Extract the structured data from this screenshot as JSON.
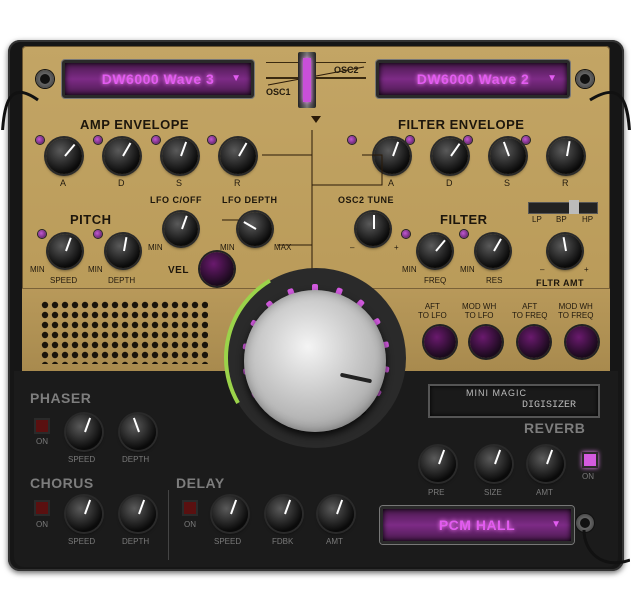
{
  "osc": {
    "osc1_wave": "DW6000 Wave 3",
    "osc2_wave": "DW6000 Wave 2",
    "osc1_label": "OSC1",
    "osc2_label": "OSC2"
  },
  "amp_envelope": {
    "title": "AMP ENVELOPE",
    "knobs": [
      "A",
      "D",
      "S",
      "R"
    ]
  },
  "filter_envelope": {
    "title": "FILTER ENVELOPE",
    "knobs": [
      "A",
      "D",
      "S",
      "R"
    ]
  },
  "pitch": {
    "title": "PITCH",
    "speed": "SPEED",
    "depth": "DEPTH",
    "min1": "MIN",
    "min2": "MIN"
  },
  "lfo": {
    "cutoff": "LFO C/OFF",
    "depth": "LFO DEPTH",
    "min1": "MIN",
    "min2": "MIN",
    "max": "MAX",
    "vel": "VEL"
  },
  "osc2_tune": {
    "title": "OSC2 TUNE",
    "minus": "–",
    "plus": "+"
  },
  "filter": {
    "title": "FILTER",
    "freq": "FREQ",
    "res": "RES",
    "min1": "MIN",
    "min2": "MIN",
    "types": [
      "LP",
      "BP",
      "HP"
    ],
    "amt": "FLTR AMT",
    "minus": "–",
    "plus": "+"
  },
  "mod": [
    "AFT\nTO LFO",
    "MOD WH\nTO LFO",
    "AFT\nTO FREQ",
    "MOD WH\nTO FREQ"
  ],
  "brand": {
    "line1": "MINI MAGIC",
    "line2": "DIGISIZER"
  },
  "phaser": {
    "title": "PHASER",
    "on": "ON",
    "speed": "SPEED",
    "depth": "DEPTH"
  },
  "chorus": {
    "title": "CHORUS",
    "on": "ON",
    "speed": "SPEED",
    "depth": "DEPTH"
  },
  "delay": {
    "title": "DELAY",
    "on": "ON",
    "speed": "SPEED",
    "fdbk": "FDBK",
    "amt": "AMT"
  },
  "reverb": {
    "title": "REVERB",
    "on": "ON",
    "pre": "PRE",
    "size": "SIZE",
    "amt": "AMT",
    "preset": "PCM HALL"
  },
  "colors": {
    "accent": "#d35be0",
    "panel": "#c3a565",
    "dark": "#1b1b1b"
  }
}
